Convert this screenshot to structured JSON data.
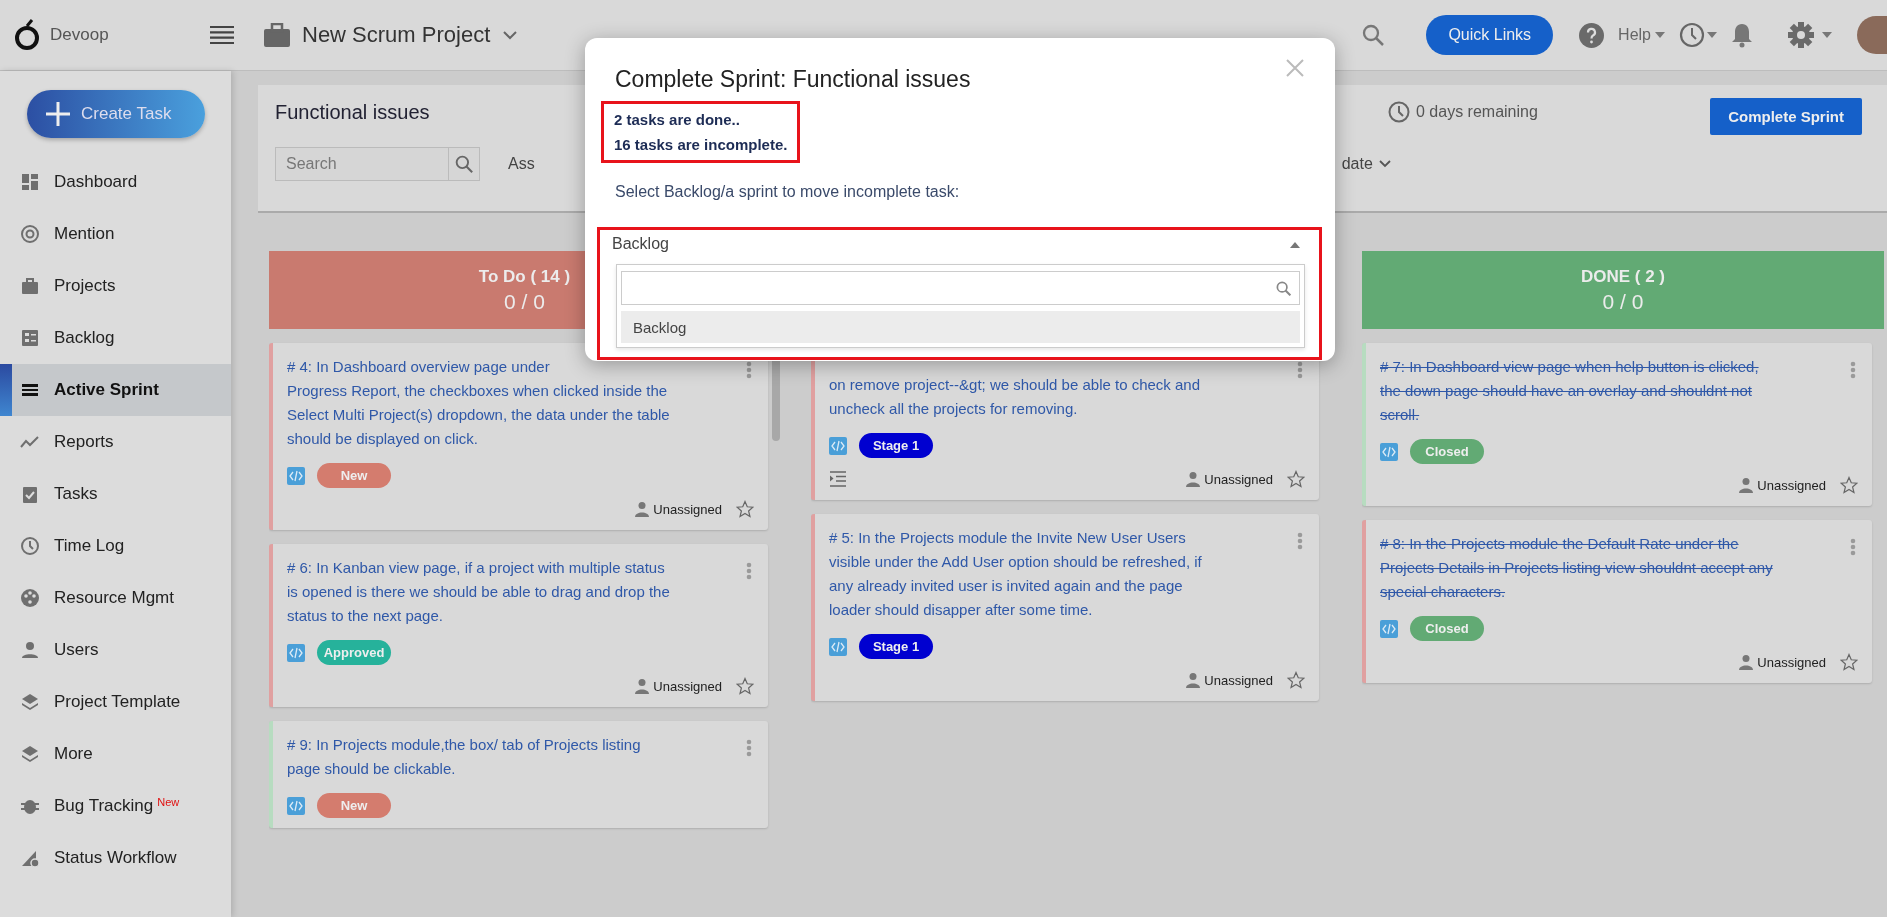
{
  "header": {
    "app_name": "Devoop",
    "project": "New Scrum Project",
    "quick_links": "Quick Links",
    "help": "Help"
  },
  "sidebar": {
    "create_button": "Create Task",
    "items": [
      {
        "label": "Dashboard",
        "selected": false
      },
      {
        "label": "Mention",
        "selected": false
      },
      {
        "label": "Projects",
        "selected": false
      },
      {
        "label": "Backlog",
        "selected": false
      },
      {
        "label": "Active Sprint",
        "selected": true
      },
      {
        "label": "Reports",
        "selected": false
      },
      {
        "label": "Tasks",
        "selected": false
      },
      {
        "label": "Time Log",
        "selected": false
      },
      {
        "label": "Resource Mgmt",
        "selected": false
      },
      {
        "label": "Users",
        "selected": false
      },
      {
        "label": "Project Template",
        "selected": false
      },
      {
        "label": "More",
        "selected": false
      },
      {
        "label": "Bug Tracking",
        "badge": "New",
        "selected": false
      },
      {
        "label": "Status Workflow",
        "selected": false
      }
    ]
  },
  "sprint": {
    "title": "Functional issues",
    "search": {
      "placeholder": "Search"
    },
    "filter_left": "Ass",
    "filter_right": "date",
    "remaining": "0 days remaining",
    "complete_button": "Complete Sprint"
  },
  "columns": [
    {
      "title": "To Do ( 14 )",
      "points": "0 / 0",
      "color": "#c97a6f",
      "scrollable": true,
      "cards": [
        {
          "lines": [
            "# 4: In Dashboard overview page under",
            "Progress Report, the checkboxes when clicked inside the",
            "Select Multi Project(s) dropdown, the data under the table",
            "should be displayed on click."
          ],
          "done": false,
          "color": "#e0a0a0",
          "status": {
            "label": "New",
            "color": "#d47c6e"
          },
          "subtasks": false,
          "assignee": "Unassigned",
          "starred": false
        },
        {
          "lines": [
            "# 6: In Kanban view page, if a project with multiple status",
            "is opened is there we should be able to drag and drop the",
            "status to the next page."
          ],
          "done": false,
          "color": "#e0a0a0",
          "status": {
            "label": "Approved",
            "color": "#26b29b"
          },
          "subtasks": false,
          "assignee": "Unassigned",
          "starred": false
        },
        {
          "lines": [
            "# 9: In Projects module,the box/ tab of Projects listing",
            "page should be clickable."
          ],
          "done": false,
          "color": "#b7dcc0",
          "status": {
            "label": "New",
            "color": "#d47c6e"
          },
          "subtasks": false
        }
      ]
    },
    {
      "cards": [
        {
          "lines": [
            "on remove project--&gt; we should be able to check and",
            "uncheck all the projects for removing."
          ],
          "done": false,
          "color": "#e0a0a0",
          "status": {
            "label": "Stage 1",
            "color": "#0000d0"
          },
          "subtasks": true,
          "assignee": "Unassigned",
          "starred": false
        },
        {
          "lines": [
            "# 5: In the Projects module the Invite New User Users",
            "visible under the Add User option should be refreshed, if",
            "any already invited user is invited again and the page",
            "loader should disapper after some time."
          ],
          "done": false,
          "color": "#e0a0a0",
          "status": {
            "label": "Stage 1",
            "color": "#0000d0"
          },
          "subtasks": false,
          "assignee": "Unassigned",
          "starred": false
        }
      ]
    },
    {
      "title": "DONE ( 2 )",
      "points": "0 / 0",
      "color": "#62aa74",
      "cards": [
        {
          "lines": [
            "# 7: In Dashboard view page when help button is clicked,",
            "the down page should have an overlay and shouldnt not",
            "scroll."
          ],
          "done": true,
          "color": "#b7dcc0",
          "status": {
            "label": "Closed",
            "color": "#62aa74"
          },
          "subtasks": false,
          "assignee": "Unassigned",
          "starred": false
        },
        {
          "lines": [
            "# 8: In the Projects module the Default Rate under the",
            "Projects Details in Projects listing view shouldnt accept any",
            "special characters."
          ],
          "done": true,
          "color": "#e0a0a0",
          "status": {
            "label": "Closed",
            "color": "#62aa74"
          },
          "subtasks": false,
          "assignee": "Unassigned",
          "starred": false
        }
      ]
    }
  ],
  "dialog": {
    "title": "Complete Sprint: Functional issues",
    "summary": {
      "lines": [
        "2 tasks are done..",
        "16 tasks are incomplete."
      ],
      "highlighted": true
    },
    "prompt": "Select Backlog/a sprint to move incomplete task:",
    "select": {
      "value": "Backlog",
      "expanded": true,
      "highlighted": true,
      "options": [
        {
          "label": "Backlog",
          "selected": true
        }
      ]
    }
  }
}
